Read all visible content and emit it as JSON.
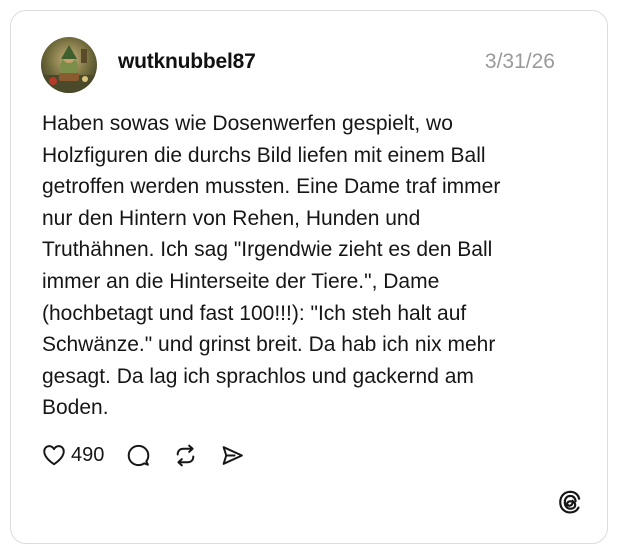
{
  "post": {
    "username": "wutknubbel87",
    "date": "3/31/26",
    "text": "Haben sowas wie Dosenwerfen gespielt, wo\nHolzfiguren die durchs Bild liefen mit einem Ball\ngetroffen werden mussten. Eine Dame traf immer\nnur den Hintern von Rehen, Hunden und\nTruthähnen. Ich sag \"Irgendwie zieht es den Ball\nimmer an die Hinterseite der Tiere.\", Dame\n(hochbetagt und fast 100!!!): \"Ich steh halt auf\nSchwänze.\" und grinst breit. Da hab ich nix mehr\ngesagt. Da lag ich sprachlos und gackernd am\nBoden.",
    "like_count": "490"
  },
  "icons": {
    "like": "heart-icon",
    "reply": "comment-icon",
    "repost": "repost-icon",
    "share": "send-icon",
    "brand": "threads-logo-icon"
  },
  "colors": {
    "text": "#161616",
    "muted": "#9a9a9a",
    "border": "#dcdcdc"
  }
}
